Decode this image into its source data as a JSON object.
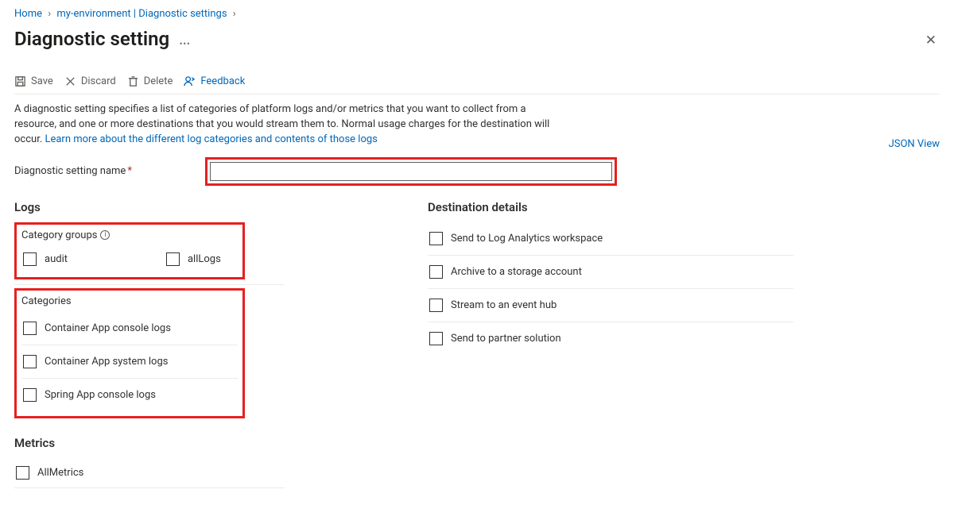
{
  "breadcrumb": {
    "home": "Home",
    "env": "my-environment | Diagnostic settings"
  },
  "page": {
    "title": "Diagnostic setting",
    "json_view": "JSON View"
  },
  "toolbar": {
    "save": "Save",
    "discard": "Discard",
    "delete": "Delete",
    "feedback": "Feedback"
  },
  "description": {
    "text": "A diagnostic setting specifies a list of categories of platform logs and/or metrics that you want to collect from a resource, and one or more destinations that you would stream them to. Normal usage charges for the destination will occur. ",
    "link": "Learn more about the different log categories and contents of those logs"
  },
  "name_field": {
    "label": "Diagnostic setting name",
    "value": ""
  },
  "logs": {
    "heading": "Logs",
    "category_groups_label": "Category groups",
    "groups": {
      "audit": "audit",
      "allLogs": "allLogs"
    },
    "categories_label": "Categories",
    "categories": [
      "Container App console logs",
      "Container App system logs",
      "Spring App console logs"
    ]
  },
  "destinations": {
    "heading": "Destination details",
    "items": [
      "Send to Log Analytics workspace",
      "Archive to a storage account",
      "Stream to an event hub",
      "Send to partner solution"
    ]
  },
  "metrics": {
    "heading": "Metrics",
    "item": "AllMetrics"
  }
}
